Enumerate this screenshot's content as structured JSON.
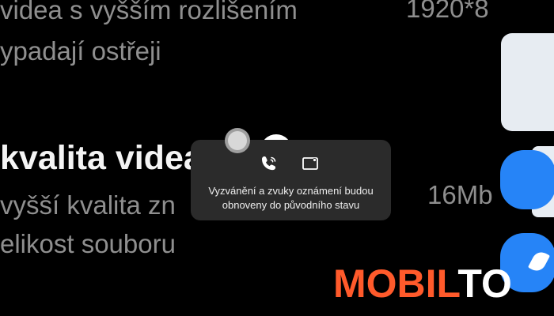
{
  "background": {
    "line1": "videa s vyšším rozlišením",
    "line2": "ypadají ostřeji",
    "title": "kvalita videa",
    "line3": "vyšší kvalita zn",
    "line4": "elikost souboru",
    "value_top": "1920*8",
    "value_mid": "16Mb"
  },
  "toast": {
    "message_line1": "Vyzvánění a zvuky oznámení budou",
    "message_line2": "obnoveny do původního stavu",
    "icons": [
      "phone-wave-icon",
      "screen-cast-icon"
    ]
  },
  "logo": {
    "part1": "MOBIL",
    "part2": "TO"
  },
  "colors": {
    "accent_blue": "#2684f7",
    "logo_orange": "#ff5a2b",
    "toast_bg": "#2b2b2b"
  }
}
